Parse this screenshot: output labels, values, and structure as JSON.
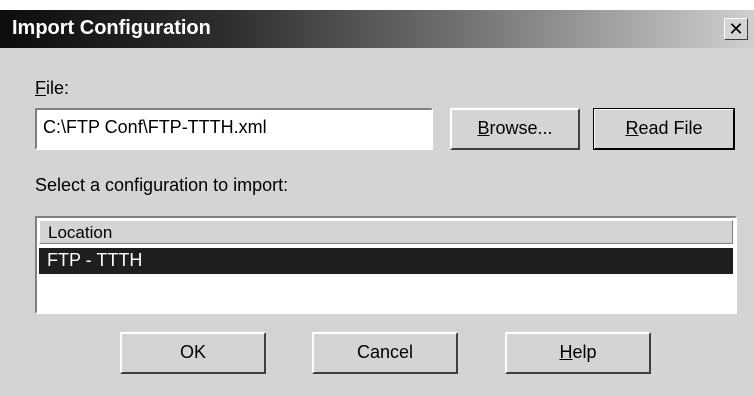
{
  "window": {
    "title": "Import Configuration",
    "close_glyph": "✕"
  },
  "file": {
    "label_accel": "F",
    "label_rest": "ile:",
    "value": "C:\\FTP Conf\\FTP-TTTH.xml"
  },
  "buttons": {
    "browse_accel": "B",
    "browse_rest": "rowse...",
    "read_accel": "R",
    "read_rest": "ead File",
    "ok": "OK",
    "cancel": "Cancel",
    "help_accel": "H",
    "help_rest": "elp"
  },
  "select_label": "Select a configuration to import:",
  "list": {
    "column": "Location",
    "rows": [
      {
        "location": "FTP - TTTH",
        "selected": true
      }
    ]
  },
  "colors": {
    "selection": "#1e1e1e",
    "face": "#d4d4d4"
  }
}
